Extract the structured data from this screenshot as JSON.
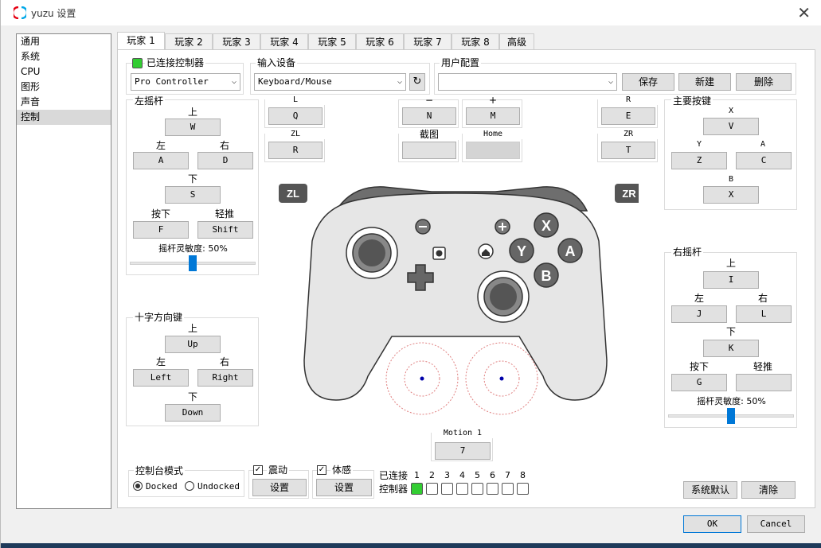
{
  "window": {
    "title": "yuzu 设置",
    "close_label": "✕"
  },
  "sidebar": {
    "items": [
      {
        "label": "通用"
      },
      {
        "label": "系统"
      },
      {
        "label": "CPU"
      },
      {
        "label": "图形"
      },
      {
        "label": "声音"
      },
      {
        "label": "控制",
        "selected": true
      }
    ]
  },
  "tabs": [
    {
      "label": "玩家 1",
      "active": true
    },
    {
      "label": "玩家 2"
    },
    {
      "label": "玩家 3"
    },
    {
      "label": "玩家 4"
    },
    {
      "label": "玩家 5"
    },
    {
      "label": "玩家 6"
    },
    {
      "label": "玩家 7"
    },
    {
      "label": "玩家 8"
    },
    {
      "label": "高级"
    }
  ],
  "connected": {
    "label": "已连接控制器",
    "controller": "Pro Controller"
  },
  "input_device": {
    "label": "输入设备",
    "value": "Keyboard/Mouse"
  },
  "profile": {
    "label": "用户配置",
    "value": "",
    "save": "保存",
    "new": "新建",
    "delete": "删除"
  },
  "left_stick": {
    "label": "左摇杆",
    "up_label": "上",
    "up": "W",
    "left_label": "左",
    "left": "A",
    "right_label": "右",
    "right": "D",
    "down_label": "下",
    "down": "S",
    "press_label": "按下",
    "press": "F",
    "nudge_label": "轻推",
    "nudge": "Shift",
    "sens_label": "摇杆灵敏度: 50%",
    "sens_value": 0.5
  },
  "dpad": {
    "label": "十字方向键",
    "up_label": "上",
    "up": "Up",
    "left_label": "左",
    "left": "Left",
    "right_label": "右",
    "right": "Right",
    "down_label": "下",
    "down": "Down"
  },
  "shoulders_left": {
    "l_label": "L",
    "l": "Q",
    "zl_label": "ZL",
    "zl": "R"
  },
  "misc": {
    "minus_label": "−",
    "minus": "N",
    "plus_label": "+",
    "plus": "M",
    "capture_label": "截图",
    "capture": "",
    "home_label": "Home",
    "home": ""
  },
  "shoulders_right": {
    "r_label": "R",
    "r": "E",
    "zr_label": "ZR",
    "zr": "T"
  },
  "face": {
    "label": "主要按键",
    "x_label": "X",
    "x": "V",
    "y_label": "Y",
    "y": "Z",
    "a_label": "A",
    "a": "C",
    "b_label": "B",
    "b": "X"
  },
  "right_stick": {
    "label": "右摇杆",
    "up_label": "上",
    "up": "I",
    "left_label": "左",
    "left": "J",
    "right_label": "右",
    "right": "L",
    "down_label": "下",
    "down": "K",
    "press_label": "按下",
    "press": "G",
    "nudge_label": "轻推",
    "nudge": "",
    "sens_label": "摇杆灵敏度: 50%",
    "sens_value": 0.5
  },
  "motion": {
    "label": "Motion 1",
    "value": "7"
  },
  "console_mode": {
    "label": "控制台模式",
    "docked": "Docked",
    "undocked": "Undocked",
    "selected": "Docked"
  },
  "vibration": {
    "label": "震动",
    "checked": true,
    "config": "设置"
  },
  "motion_cfg": {
    "label": "体感",
    "checked": true,
    "config": "设置"
  },
  "connected_leds": {
    "label1": "已连接",
    "label2": "控制器",
    "numbers": [
      "1",
      "2",
      "3",
      "4",
      "5",
      "6",
      "7",
      "8"
    ],
    "active": [
      true,
      false,
      false,
      false,
      false,
      false,
      false,
      false
    ]
  },
  "controller_image": {
    "zl": "ZL",
    "zr": "ZR",
    "x": "X",
    "y": "Y",
    "a": "A",
    "b": "B"
  },
  "actions": {
    "defaults": "系统默认",
    "clear": "清除",
    "ok": "OK",
    "cancel": "Cancel"
  },
  "colors": {
    "led_on": "#32cd32",
    "accent": "#0078d7"
  }
}
